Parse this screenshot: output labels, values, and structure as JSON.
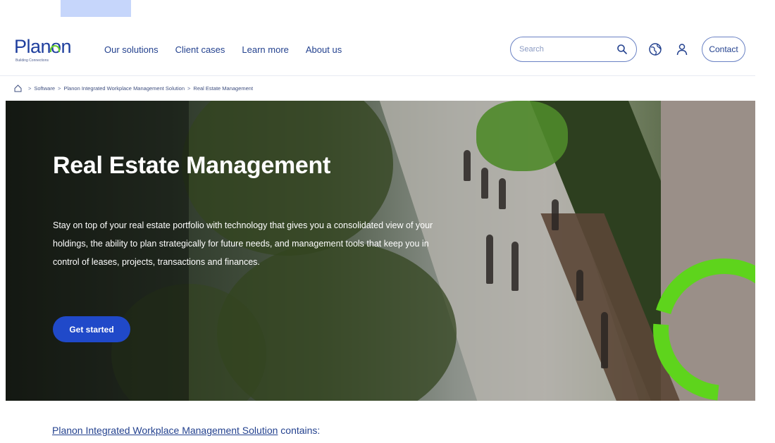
{
  "brand": {
    "name": "Planon",
    "tagline": "Building Connections"
  },
  "nav": {
    "items": [
      "Our solutions",
      "Client cases",
      "Learn more",
      "About us"
    ]
  },
  "header": {
    "search_placeholder": "Search",
    "search_value": "",
    "contact_label": "Contact"
  },
  "breadcrumb": {
    "items": [
      "Software",
      "Planon Integrated Workplace Management Solution",
      "Real Estate Management"
    ],
    "separator": ">"
  },
  "hero": {
    "title": "Real Estate Management",
    "description": "Stay on top of your real estate portfolio with technology that gives you a consolidated view of your holdings, the ability to plan strategically for future needs, and management tools that keep you in control of leases, projects, transactions and finances.",
    "cta_label": "Get started"
  },
  "contains": {
    "link_text": "Planon Integrated Workplace Management Solution",
    "suffix": " contains:"
  },
  "colors": {
    "brand_blue": "#1f3f9e",
    "nav_blue": "#24428f",
    "cta_blue": "#2049c9",
    "accent_green": "#5ed41c",
    "top_highlight": "#c6d6fb"
  },
  "icons": {
    "search": "search-icon",
    "language": "globe-icon",
    "account": "user-icon",
    "home": "home-icon"
  }
}
